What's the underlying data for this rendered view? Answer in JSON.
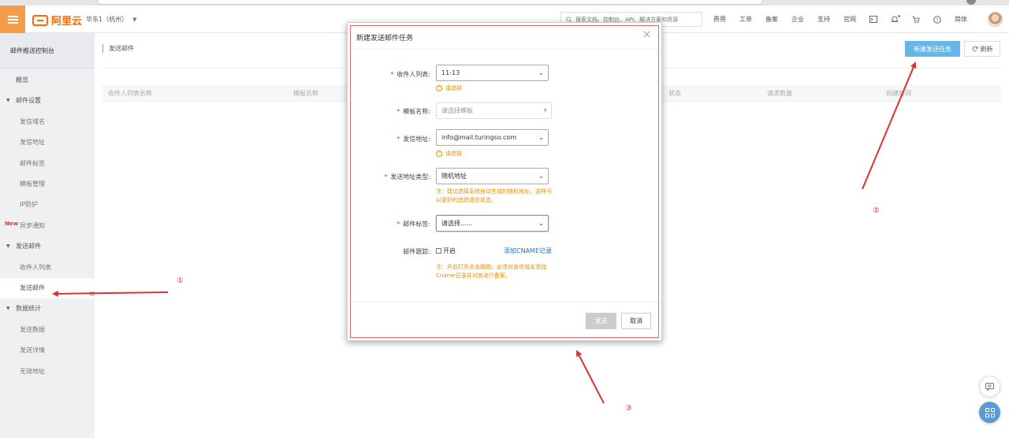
{
  "header": {
    "brand": "阿里云",
    "region": "华东1（杭州）",
    "search_placeholder": "搜索文档、控制台、API、解决方案和资源",
    "nav_items": [
      "费用",
      "工单",
      "备案",
      "企业",
      "支持",
      "官网"
    ],
    "language": "简体"
  },
  "sidebar": {
    "title": "邮件推送控制台",
    "items": [
      {
        "label": "概览",
        "type": "l1"
      },
      {
        "label": "邮件设置",
        "type": "group"
      },
      {
        "label": "发信域名",
        "type": "l2"
      },
      {
        "label": "发信地址",
        "type": "l2"
      },
      {
        "label": "邮件标签",
        "type": "l2"
      },
      {
        "label": "模板管理",
        "type": "l2"
      },
      {
        "label": "IP防护",
        "type": "l2"
      },
      {
        "label": "异步通知",
        "type": "l2",
        "badge": "New"
      },
      {
        "label": "发送邮件",
        "type": "group"
      },
      {
        "label": "收件人列表",
        "type": "l2"
      },
      {
        "label": "发送邮件",
        "type": "l2",
        "active": true
      },
      {
        "label": "数据统计",
        "type": "group"
      },
      {
        "label": "发送数据",
        "type": "l2"
      },
      {
        "label": "发送详情",
        "type": "l2"
      },
      {
        "label": "无效地址",
        "type": "l2"
      }
    ]
  },
  "main": {
    "breadcrumb": "发送邮件",
    "new_task_button": "新建发送任务",
    "refresh_button": "刷新",
    "table_headers": [
      "收件人列表名称",
      "模板名称",
      "状态",
      "请求数量",
      "创建时间"
    ]
  },
  "modal": {
    "title": "新建发送邮件任务",
    "fields": {
      "recipients": {
        "label": "收件人列表:",
        "value": "11-13",
        "error": "请选择"
      },
      "template": {
        "label": "模板名称:",
        "placeholder": "请选择模板"
      },
      "sender": {
        "label": "发信地址:",
        "value": "info@mail.turingso.com",
        "error": "请选择"
      },
      "address_type": {
        "label": "发送地址类型:",
        "value": "随机地址",
        "note": "注：建议选择系统自动生成的随机地址，这样可以更好的追踪退信状态。"
      },
      "tag": {
        "label": "邮件标签:",
        "value": "请选择......"
      },
      "tracking": {
        "label": "邮件跟踪:",
        "checkbox_label": "开启",
        "link": "添加CNAME记录",
        "note": "注：开启打开点击跟踪，必须对发信域名添加Cname记录并对其进行备案。"
      }
    },
    "send_button": "发送",
    "cancel_button": "取消"
  },
  "annotations": [
    "①",
    "②",
    "③"
  ],
  "colors": {
    "accent": "#ff6a00",
    "primary_button": "#68b5e7",
    "warning": "#f08c00",
    "annotation": "#e03030",
    "link": "#1a73c8"
  }
}
